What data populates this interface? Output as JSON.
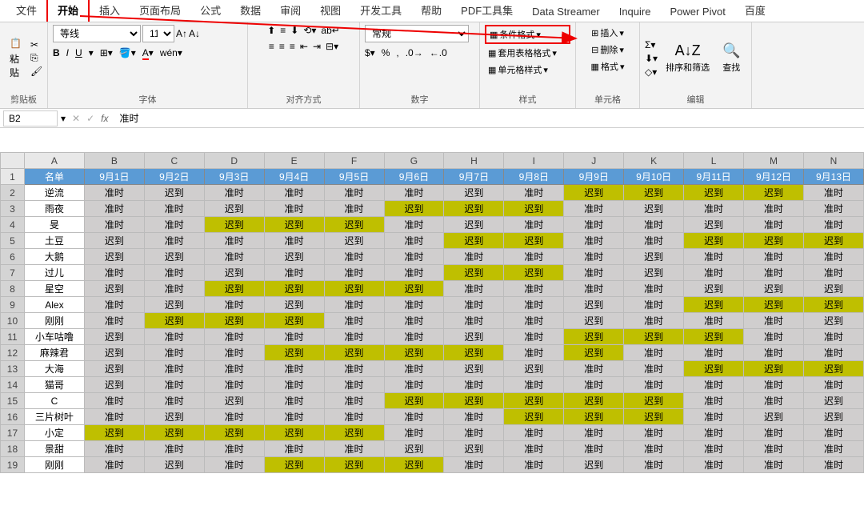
{
  "tabs": [
    "文件",
    "开始",
    "插入",
    "页面布局",
    "公式",
    "数据",
    "审阅",
    "视图",
    "开发工具",
    "帮助",
    "PDF工具集",
    "Data Streamer",
    "Inquire",
    "Power Pivot",
    "百度"
  ],
  "active_tab": 1,
  "ribbon": {
    "clipboard": {
      "paste": "粘贴",
      "label": "剪贴板"
    },
    "font": {
      "name": "等线",
      "size": "11",
      "label": "字体",
      "bold": "B",
      "italic": "I",
      "underline": "U"
    },
    "align": {
      "label": "对齐方式"
    },
    "number": {
      "format": "常规",
      "label": "数字"
    },
    "style": {
      "cond": "条件格式",
      "tablefmt": "套用表格格式",
      "cellstyle": "单元格样式",
      "label": "样式"
    },
    "cells": {
      "insert": "插入",
      "delete": "删除",
      "format": "格式",
      "label": "单元格"
    },
    "editing": {
      "sort": "排序和筛选",
      "find": "查找",
      "label": "编辑"
    }
  },
  "formula_bar": {
    "cell": "B2",
    "value": "准时"
  },
  "col_letters": [
    "A",
    "B",
    "C",
    "D",
    "E",
    "F",
    "G",
    "H",
    "I",
    "J",
    "K",
    "L",
    "M",
    "N"
  ],
  "header_cells": [
    "名单",
    "9月1日",
    "9月2日",
    "9月3日",
    "9月4日",
    "9月5日",
    "9月6日",
    "9月7日",
    "9月8日",
    "9月9日",
    "9月10日",
    "9月11日",
    "9月12日",
    "9月13日"
  ],
  "chart_data": {
    "type": "table",
    "legend": {
      "准时": "on-time (gray)",
      "迟到": "late (gray or yellow-highlight)"
    },
    "rows": [
      {
        "name": "逆流",
        "cells": [
          [
            "准时",
            "w"
          ],
          [
            "迟到",
            "w"
          ],
          [
            "准时",
            "w"
          ],
          [
            "准时",
            "w"
          ],
          [
            "准时",
            "w"
          ],
          [
            "准时",
            "w"
          ],
          [
            "迟到",
            "w"
          ],
          [
            "准时",
            "w"
          ],
          [
            "迟到",
            "y"
          ],
          [
            "迟到",
            "y"
          ],
          [
            "迟到",
            "y"
          ],
          [
            "迟到",
            "y"
          ],
          [
            "准时",
            "w"
          ]
        ]
      },
      {
        "name": "雨夜",
        "cells": [
          [
            "准时",
            "w"
          ],
          [
            "准时",
            "w"
          ],
          [
            "迟到",
            "w"
          ],
          [
            "准时",
            "w"
          ],
          [
            "准时",
            "w"
          ],
          [
            "迟到",
            "y"
          ],
          [
            "迟到",
            "y"
          ],
          [
            "迟到",
            "y"
          ],
          [
            "准时",
            "w"
          ],
          [
            "迟到",
            "w"
          ],
          [
            "准时",
            "w"
          ],
          [
            "准时",
            "w"
          ],
          [
            "准时",
            "w"
          ]
        ]
      },
      {
        "name": "旻",
        "cells": [
          [
            "准时",
            "w"
          ],
          [
            "准时",
            "w"
          ],
          [
            "迟到",
            "y"
          ],
          [
            "迟到",
            "y"
          ],
          [
            "迟到",
            "y"
          ],
          [
            "准时",
            "w"
          ],
          [
            "迟到",
            "w"
          ],
          [
            "准时",
            "w"
          ],
          [
            "准时",
            "w"
          ],
          [
            "准时",
            "w"
          ],
          [
            "迟到",
            "w"
          ],
          [
            "准时",
            "w"
          ],
          [
            "准时",
            "w"
          ]
        ]
      },
      {
        "name": "土豆",
        "cells": [
          [
            "迟到",
            "w"
          ],
          [
            "准时",
            "w"
          ],
          [
            "准时",
            "w"
          ],
          [
            "准时",
            "w"
          ],
          [
            "迟到",
            "w"
          ],
          [
            "准时",
            "w"
          ],
          [
            "迟到",
            "y"
          ],
          [
            "迟到",
            "y"
          ],
          [
            "准时",
            "w"
          ],
          [
            "准时",
            "w"
          ],
          [
            "迟到",
            "y"
          ],
          [
            "迟到",
            "y"
          ],
          [
            "迟到",
            "y"
          ]
        ]
      },
      {
        "name": "大鹅",
        "cells": [
          [
            "迟到",
            "w"
          ],
          [
            "迟到",
            "w"
          ],
          [
            "准时",
            "w"
          ],
          [
            "迟到",
            "w"
          ],
          [
            "准时",
            "w"
          ],
          [
            "准时",
            "w"
          ],
          [
            "准时",
            "w"
          ],
          [
            "准时",
            "w"
          ],
          [
            "准时",
            "w"
          ],
          [
            "迟到",
            "w"
          ],
          [
            "准时",
            "w"
          ],
          [
            "准时",
            "w"
          ],
          [
            "准时",
            "w"
          ]
        ]
      },
      {
        "name": "过儿",
        "cells": [
          [
            "准时",
            "w"
          ],
          [
            "准时",
            "w"
          ],
          [
            "迟到",
            "w"
          ],
          [
            "准时",
            "w"
          ],
          [
            "准时",
            "w"
          ],
          [
            "准时",
            "w"
          ],
          [
            "迟到",
            "y"
          ],
          [
            "迟到",
            "y"
          ],
          [
            "准时",
            "w"
          ],
          [
            "迟到",
            "w"
          ],
          [
            "准时",
            "w"
          ],
          [
            "准时",
            "w"
          ],
          [
            "准时",
            "w"
          ]
        ]
      },
      {
        "name": "星空",
        "cells": [
          [
            "迟到",
            "w"
          ],
          [
            "准时",
            "w"
          ],
          [
            "迟到",
            "y"
          ],
          [
            "迟到",
            "y"
          ],
          [
            "迟到",
            "y"
          ],
          [
            "迟到",
            "y"
          ],
          [
            "准时",
            "w"
          ],
          [
            "准时",
            "w"
          ],
          [
            "准时",
            "w"
          ],
          [
            "准时",
            "w"
          ],
          [
            "迟到",
            "w"
          ],
          [
            "迟到",
            "w"
          ],
          [
            "迟到",
            "w"
          ]
        ]
      },
      {
        "name": "Alex",
        "cells": [
          [
            "准时",
            "w"
          ],
          [
            "迟到",
            "w"
          ],
          [
            "准时",
            "w"
          ],
          [
            "迟到",
            "w"
          ],
          [
            "准时",
            "w"
          ],
          [
            "准时",
            "w"
          ],
          [
            "准时",
            "w"
          ],
          [
            "准时",
            "w"
          ],
          [
            "迟到",
            "w"
          ],
          [
            "准时",
            "w"
          ],
          [
            "迟到",
            "y"
          ],
          [
            "迟到",
            "y"
          ],
          [
            "迟到",
            "y"
          ]
        ]
      },
      {
        "name": "刚刚",
        "cells": [
          [
            "准时",
            "w"
          ],
          [
            "迟到",
            "y"
          ],
          [
            "迟到",
            "y"
          ],
          [
            "迟到",
            "y"
          ],
          [
            "准时",
            "w"
          ],
          [
            "准时",
            "w"
          ],
          [
            "准时",
            "w"
          ],
          [
            "准时",
            "w"
          ],
          [
            "迟到",
            "w"
          ],
          [
            "准时",
            "w"
          ],
          [
            "准时",
            "w"
          ],
          [
            "准时",
            "w"
          ],
          [
            "迟到",
            "w"
          ]
        ]
      },
      {
        "name": "小车咕噜",
        "cells": [
          [
            "迟到",
            "w"
          ],
          [
            "准时",
            "w"
          ],
          [
            "准时",
            "w"
          ],
          [
            "准时",
            "w"
          ],
          [
            "准时",
            "w"
          ],
          [
            "准时",
            "w"
          ],
          [
            "迟到",
            "w"
          ],
          [
            "准时",
            "w"
          ],
          [
            "迟到",
            "y"
          ],
          [
            "迟到",
            "y"
          ],
          [
            "迟到",
            "y"
          ],
          [
            "准时",
            "w"
          ],
          [
            "准时",
            "w"
          ]
        ]
      },
      {
        "name": "麻辣君",
        "cells": [
          [
            "迟到",
            "w"
          ],
          [
            "准时",
            "w"
          ],
          [
            "准时",
            "w"
          ],
          [
            "迟到",
            "y"
          ],
          [
            "迟到",
            "y"
          ],
          [
            "迟到",
            "y"
          ],
          [
            "迟到",
            "y"
          ],
          [
            "准时",
            "w"
          ],
          [
            "迟到",
            "y"
          ],
          [
            "准时",
            "w"
          ],
          [
            "准时",
            "w"
          ],
          [
            "准时",
            "w"
          ],
          [
            "准时",
            "w"
          ]
        ]
      },
      {
        "name": "大海",
        "cells": [
          [
            "迟到",
            "w"
          ],
          [
            "准时",
            "w"
          ],
          [
            "准时",
            "w"
          ],
          [
            "准时",
            "w"
          ],
          [
            "准时",
            "w"
          ],
          [
            "准时",
            "w"
          ],
          [
            "迟到",
            "w"
          ],
          [
            "迟到",
            "w"
          ],
          [
            "准时",
            "w"
          ],
          [
            "准时",
            "w"
          ],
          [
            "迟到",
            "y"
          ],
          [
            "迟到",
            "y"
          ],
          [
            "迟到",
            "y"
          ]
        ]
      },
      {
        "name": "猫哥",
        "cells": [
          [
            "迟到",
            "w"
          ],
          [
            "准时",
            "w"
          ],
          [
            "准时",
            "w"
          ],
          [
            "准时",
            "w"
          ],
          [
            "准时",
            "w"
          ],
          [
            "准时",
            "w"
          ],
          [
            "准时",
            "w"
          ],
          [
            "准时",
            "w"
          ],
          [
            "准时",
            "w"
          ],
          [
            "准时",
            "w"
          ],
          [
            "准时",
            "w"
          ],
          [
            "准时",
            "w"
          ],
          [
            "准时",
            "w"
          ]
        ]
      },
      {
        "name": "C",
        "cells": [
          [
            "准时",
            "w"
          ],
          [
            "准时",
            "w"
          ],
          [
            "迟到",
            "w"
          ],
          [
            "准时",
            "w"
          ],
          [
            "准时",
            "w"
          ],
          [
            "迟到",
            "y"
          ],
          [
            "迟到",
            "y"
          ],
          [
            "迟到",
            "y"
          ],
          [
            "迟到",
            "y"
          ],
          [
            "迟到",
            "y"
          ],
          [
            "准时",
            "w"
          ],
          [
            "准时",
            "w"
          ],
          [
            "迟到",
            "w"
          ]
        ]
      },
      {
        "name": "三片树叶",
        "cells": [
          [
            "准时",
            "w"
          ],
          [
            "迟到",
            "w"
          ],
          [
            "准时",
            "w"
          ],
          [
            "准时",
            "w"
          ],
          [
            "准时",
            "w"
          ],
          [
            "准时",
            "w"
          ],
          [
            "准时",
            "w"
          ],
          [
            "迟到",
            "y"
          ],
          [
            "迟到",
            "y"
          ],
          [
            "迟到",
            "y"
          ],
          [
            "准时",
            "w"
          ],
          [
            "迟到",
            "w"
          ],
          [
            "迟到",
            "w"
          ]
        ]
      },
      {
        "name": "小定",
        "cells": [
          [
            "迟到",
            "y"
          ],
          [
            "迟到",
            "y"
          ],
          [
            "迟到",
            "y"
          ],
          [
            "迟到",
            "y"
          ],
          [
            "迟到",
            "y"
          ],
          [
            "准时",
            "w"
          ],
          [
            "准时",
            "w"
          ],
          [
            "准时",
            "w"
          ],
          [
            "准时",
            "w"
          ],
          [
            "准时",
            "w"
          ],
          [
            "准时",
            "w"
          ],
          [
            "准时",
            "w"
          ],
          [
            "准时",
            "w"
          ]
        ]
      },
      {
        "name": "景甜",
        "cells": [
          [
            "准时",
            "w"
          ],
          [
            "准时",
            "w"
          ],
          [
            "准时",
            "w"
          ],
          [
            "准时",
            "w"
          ],
          [
            "准时",
            "w"
          ],
          [
            "迟到",
            "w"
          ],
          [
            "迟到",
            "w"
          ],
          [
            "准时",
            "w"
          ],
          [
            "准时",
            "w"
          ],
          [
            "准时",
            "w"
          ],
          [
            "准时",
            "w"
          ],
          [
            "准时",
            "w"
          ],
          [
            "准时",
            "w"
          ]
        ]
      },
      {
        "name": "刚刚",
        "cells": [
          [
            "准时",
            "w"
          ],
          [
            "迟到",
            "w"
          ],
          [
            "准时",
            "w"
          ],
          [
            "迟到",
            "y"
          ],
          [
            "迟到",
            "y"
          ],
          [
            "迟到",
            "y"
          ],
          [
            "准时",
            "w"
          ],
          [
            "准时",
            "w"
          ],
          [
            "迟到",
            "w"
          ],
          [
            "准时",
            "w"
          ],
          [
            "准时",
            "w"
          ],
          [
            "准时",
            "w"
          ],
          [
            "准时",
            "w"
          ]
        ]
      }
    ]
  }
}
